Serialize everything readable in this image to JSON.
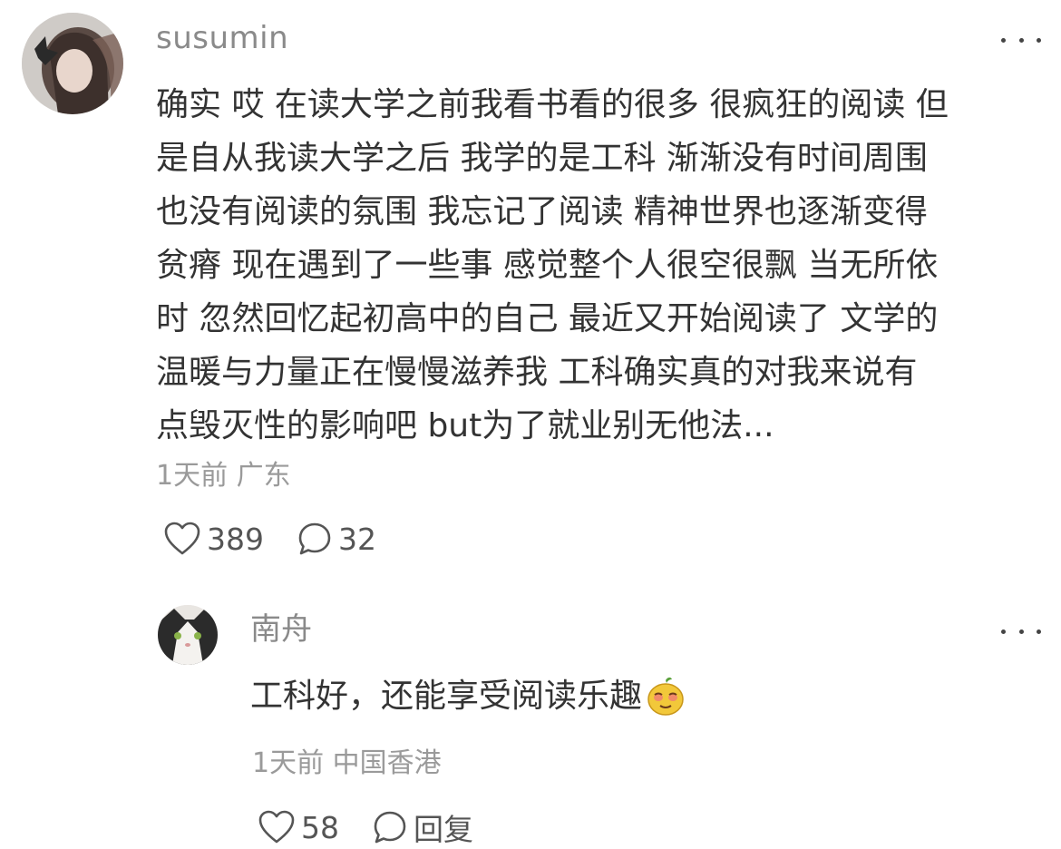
{
  "comment": {
    "username": "susumin",
    "body": "确实 哎 在读大学之前我看书看的很多 很疯狂的阅读 但\n是自从我读大学之后 我学的是工科 渐渐没有时间周围\n也没有阅读的氛围 我忘记了阅读 精神世界也逐渐变得\n贫瘠 现在遇到了一些事 感觉整个人很空很飘 当无所依\n时 忽然回忆起初高中的自己 最近又开始阅读了 文学的\n温暖与力量正在慢慢滋养我 工科确实真的对我来说有\n点毁灭性的影响吧 but为了就业别无他法...",
    "time": "1天前",
    "location": "广东",
    "likes": "389",
    "replies": "32",
    "avatar_icon": "avatar-photo-icon",
    "more_icon": "more-dots-icon"
  },
  "reply": {
    "username": "南舟",
    "body": "工科好，还能享受阅读乐趣",
    "emoji_icon": "smug-face-emoji-icon",
    "time": "1天前",
    "location": "中国香港",
    "likes": "58",
    "reply_label": "回复",
    "avatar_icon": "cat-avatar-icon",
    "more_icon": "more-dots-icon"
  }
}
